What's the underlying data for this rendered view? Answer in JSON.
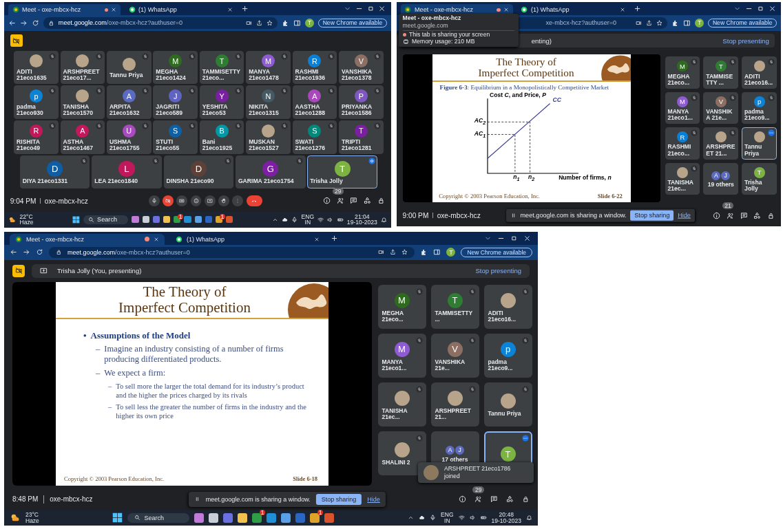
{
  "screens": [
    {
      "browser": {
        "tabs": [
          {
            "kind": "meet",
            "title": "Meet - oxe-mbcx-hcz",
            "selected": true,
            "recording": true
          },
          {
            "kind": "whatsapp",
            "title": "(1) WhatsApp",
            "selected": false,
            "recording": false
          }
        ],
        "url": {
          "host": "meet.google.com",
          "path": "/oxe-mbcx-hcz?authuser=0"
        },
        "profile": "T",
        "update": "New Chrome available"
      },
      "camera_off": true,
      "tile_rows": [
        [
          {
            "name": "ADITI 21eco1635",
            "kind": "photo",
            "muted": true,
            "selected": false
          },
          {
            "name": "ARSHPREET 21eco17...",
            "kind": "photo",
            "muted": true,
            "selected": false
          },
          {
            "name": "Tannu Priya",
            "kind": "photo",
            "muted": true,
            "selected": false
          },
          {
            "name": "MEGHA 21eco1424",
            "kind": "letter",
            "letter": "M",
            "color": "#2e6b1f",
            "muted": true,
            "selected": false
          },
          {
            "name": "TAMMISETTY 21eco...",
            "kind": "letter",
            "letter": "T",
            "color": "#2e7d32",
            "muted": true,
            "selected": false
          },
          {
            "name": "MANYA 21eco1478",
            "kind": "letter",
            "letter": "M",
            "color": "#8e5bd0",
            "muted": true,
            "selected": false
          },
          {
            "name": "RASHMI 21eco1936",
            "kind": "letter",
            "letter": "R",
            "color": "#0b7fd4",
            "muted": true,
            "selected": false
          },
          {
            "name": "VANSHIKA 21eco1378",
            "kind": "letter",
            "letter": "V",
            "color": "#8d6e63",
            "muted": true,
            "selected": false
          }
        ],
        [
          {
            "name": "padma 21eco930",
            "kind": "letter",
            "letter": "p",
            "color": "#0b84d8",
            "muted": true,
            "selected": false
          },
          {
            "name": "TANISHA 21eco1570",
            "kind": "photo",
            "muted": true,
            "selected": false
          },
          {
            "name": "ARPITA 21eco1632",
            "kind": "letter",
            "letter": "A",
            "color": "#5c6bc0",
            "muted": true,
            "selected": false
          },
          {
            "name": "JAGRITI 21eco589",
            "kind": "letter",
            "letter": "J",
            "color": "#5f63c4",
            "muted": true,
            "selected": false
          },
          {
            "name": "YESHITA 21eco53",
            "kind": "letter",
            "letter": "Y",
            "color": "#7b1fa2",
            "muted": true,
            "selected": false
          },
          {
            "name": "NIKITA 21eco1315",
            "kind": "letter",
            "letter": "N",
            "color": "#455a64",
            "muted": true,
            "selected": false
          },
          {
            "name": "AASTHA 21eco1288",
            "kind": "letter",
            "letter": "A",
            "color": "#ab47bc",
            "muted": true,
            "selected": false
          },
          {
            "name": "PRIYANKA 21eco1586",
            "kind": "letter",
            "letter": "P",
            "color": "#7e57c2",
            "muted": true,
            "selected": false
          }
        ],
        [
          {
            "name": "RISHITA 21eco49",
            "kind": "letter",
            "letter": "R",
            "color": "#c2185b",
            "muted": true,
            "selected": false
          },
          {
            "name": "ASTHA 21eco1467",
            "kind": "letter",
            "letter": "A",
            "color": "#c4185c",
            "muted": true,
            "selected": false
          },
          {
            "name": "USHMA 21eco1755",
            "kind": "letter",
            "letter": "U",
            "color": "#a94bc0",
            "muted": true,
            "selected": false
          },
          {
            "name": "STUTI 21eco55",
            "kind": "letter",
            "letter": "S",
            "color": "#0d5fa6",
            "muted": true,
            "selected": false
          },
          {
            "name": "Bani 21eco1925",
            "kind": "letter",
            "letter": "B",
            "color": "#0097a7",
            "muted": true,
            "selected": false
          },
          {
            "name": "MUSKAN 21eco1527",
            "kind": "photo",
            "muted": true,
            "selected": false
          },
          {
            "name": "SWATI 21eco1276",
            "kind": "letter",
            "letter": "S",
            "color": "#00897b",
            "muted": true,
            "selected": false
          },
          {
            "name": "TRIPTI 21eco1281",
            "kind": "letter",
            "letter": "T",
            "color": "#7a1fa0",
            "muted": true,
            "selected": false
          }
        ],
        [
          {
            "name": "DIYA 21eco1331",
            "kind": "letter",
            "letter": "D",
            "color": "#0e5ea5",
            "muted": true,
            "selected": false
          },
          {
            "name": "LEA 21eco1840",
            "kind": "letter",
            "letter": "L",
            "color": "#c0185a",
            "muted": true,
            "selected": false
          },
          {
            "name": "DINSHA 21eco90",
            "kind": "letter",
            "letter": "D",
            "color": "#5d4037",
            "muted": true,
            "selected": false
          },
          {
            "name": "GARIMA 21eco1754",
            "kind": "letter",
            "letter": "G",
            "color": "#7c1fa3",
            "muted": true,
            "selected": false
          },
          {
            "name": "Trisha Jolly",
            "kind": "letter",
            "letter": "T",
            "color": "#7cb342",
            "muted": false,
            "speaking": true,
            "selected": true
          }
        ]
      ],
      "meeting": {
        "time": "9:04 PM",
        "code": "oxe-mbcx-hcz",
        "participants": "29"
      },
      "taskbar": {
        "temperature": "22°C",
        "weather": "Haze",
        "search": "Search",
        "badges": [
          "1",
          "1"
        ],
        "language": "ENG",
        "region": "IN",
        "time": "21:04",
        "date": "19-10-2023"
      }
    },
    {
      "browser": {
        "tabs": [
          {
            "kind": "meet",
            "title": "Meet - oxe-mbcx-hcz",
            "selected": true,
            "recording": true
          },
          {
            "kind": "whatsapp",
            "title": "(1) WhatsApp",
            "selected": false,
            "recording": false
          }
        ],
        "url": {
          "path": "xe-mbcx-hcz?authuser=0"
        },
        "profile": "T",
        "update": "New Chrome available"
      },
      "tooltip": {
        "title": "Meet - oxe-mbcx-hcz",
        "site": "meet.google.com",
        "sharing": "This tab is sharing your screen",
        "memory": "Memory usage: 210 MB"
      },
      "presenting": {
        "text": "enting)",
        "stop": "Stop presenting"
      },
      "slide": {
        "title": [
          "The Theory of",
          "Imperfect Competition"
        ],
        "caption": "**Figure 6-3**: Equilibrium in a Monopolistically Competitive Market",
        "figure": {
          "y_label": "Cost *C*, and Price, *P*",
          "curve": "CC",
          "y_marks": [
            "AC$_{2}$",
            "AC$_{1}$"
          ],
          "x_marks": [
            "n$_{1}$",
            "n$_{2}$"
          ],
          "x_label": "Number of firms, *n*"
        },
        "copyright": "Copyright © 2003 Pearson Education, Inc.",
        "number": "Slide 6-22"
      },
      "tile_rows": [
        [
          {
            "name": "MEGHA 21eco...",
            "kind": "letter",
            "letter": "M",
            "color": "#2e6b1f",
            "muted": true,
            "selected": false
          },
          {
            "name": "TAMMISETTY ...",
            "kind": "letter",
            "letter": "T",
            "color": "#2e7d32",
            "muted": true,
            "selected": false
          },
          {
            "name": "ADITI 21eco16...",
            "kind": "photo",
            "muted": true,
            "selected": false
          }
        ],
        [
          {
            "name": "MANYA 21eco1...",
            "kind": "letter",
            "letter": "M",
            "color": "#8e5bd0",
            "muted": true,
            "selected": false
          },
          {
            "name": "VANSHIKA 21e...",
            "kind": "letter",
            "letter": "V",
            "color": "#8d6e63",
            "muted": true,
            "selected": false
          },
          {
            "name": "padma 21eco9...",
            "kind": "letter",
            "letter": "p",
            "color": "#0b84d8",
            "muted": true,
            "selected": false
          }
        ],
        [
          {
            "name": "RASHMI 21eco...",
            "kind": "letter",
            "letter": "R",
            "color": "#0b7fd4",
            "muted": true,
            "selected": false
          },
          {
            "name": "ARSHPREET 21...",
            "kind": "photo",
            "muted": true,
            "selected": false
          },
          {
            "name": "Tannu Priya",
            "kind": "photo",
            "muted": false,
            "menu": true,
            "selected": true
          }
        ],
        [
          {
            "name": "TANISHA 21ec...",
            "kind": "photo",
            "muted": true,
            "selected": false
          },
          {
            "name": "19 others",
            "kind": "group",
            "letters": [
              "A",
              "J"
            ],
            "color": "#5c6bc0",
            "muted": false,
            "selected": false
          },
          {
            "name": "Trisha Jolly",
            "kind": "letter",
            "letter": "T",
            "color": "#7cb342",
            "muted": false,
            "selected": false
          }
        ]
      ],
      "meeting": {
        "time": "9:00 PM",
        "code": "oxe-mbcx-hcz",
        "participants": "21"
      },
      "share_notice": {
        "text": "meet.google.com is sharing a window.",
        "stop": "Stop sharing",
        "hide": "Hide"
      }
    },
    {
      "browser": {
        "tabs": [
          {
            "kind": "meet",
            "title": "Meet - oxe-mbcx-hcz",
            "selected": true,
            "recording": true
          },
          {
            "kind": "whatsapp",
            "title": "(1) WhatsApp",
            "selected": false,
            "recording": false
          }
        ],
        "url": {
          "host": "meet.google.com",
          "path": "/oxe-mbcx-hcz?authuser=0"
        },
        "profile": "T",
        "update": "New Chrome available"
      },
      "camera_off": true,
      "presenting": {
        "text": "Trisha Jolly (You, presenting)",
        "stop": "Stop presenting"
      },
      "slide": {
        "title": [
          "The Theory of",
          "Imperfect Competition"
        ],
        "bullets": [
          {
            "marker": "•",
            "text": "Assumptions of the Model",
            "children": [
              {
                "marker": "–",
                "text": "Imagine an industry consisting of a number of firms producing differentiated products."
              },
              {
                "marker": "–",
                "text": "We expect a firm:",
                "children": [
                  {
                    "marker": "–",
                    "text": "To sell more the larger the total demand for its industry’s product and the higher the prices charged by its rivals"
                  },
                  {
                    "marker": "–",
                    "text": "To sell less the greater the number of firms in the industry and the higher its own price"
                  }
                ]
              }
            ]
          }
        ],
        "copyright": "Copyright © 2003 Pearson Education, Inc.",
        "number": "Slide 6-18"
      },
      "tile_rows": [
        [
          {
            "name": "MEGHA 21eco...",
            "kind": "letter",
            "letter": "M",
            "color": "#2e6b1f",
            "muted": true,
            "selected": false
          },
          {
            "name": "TAMMISETTY ...",
            "kind": "letter",
            "letter": "T",
            "color": "#2e7d32",
            "muted": true,
            "selected": false
          },
          {
            "name": "ADITI 21eco16...",
            "kind": "photo",
            "muted": true,
            "selected": false
          }
        ],
        [
          {
            "name": "MANYA 21eco1...",
            "kind": "letter",
            "letter": "M",
            "color": "#8e5bd0",
            "muted": true,
            "selected": false
          },
          {
            "name": "VANSHIKA 21e...",
            "kind": "letter",
            "letter": "V",
            "color": "#8d6e63",
            "muted": true,
            "selected": false
          },
          {
            "name": "padma 21eco9...",
            "kind": "letter",
            "letter": "p",
            "color": "#0b84d8",
            "muted": true,
            "selected": false
          }
        ],
        [
          {
            "name": "TANISHA 21ec...",
            "kind": "photo",
            "muted": true,
            "selected": false
          },
          {
            "name": "ARSHPREET 21...",
            "kind": "photo",
            "muted": true,
            "selected": false
          },
          {
            "name": "Tannu Priya",
            "kind": "photo",
            "muted": true,
            "selected": false
          }
        ],
        [
          {
            "name": "SHALINI 2",
            "kind": "photo",
            "muted": true,
            "selected": false
          },
          {
            "name": "17 others",
            "kind": "group",
            "letters": [
              "A",
              "J"
            ],
            "color": "#5c6bc0",
            "muted": false,
            "selected": false
          },
          {
            "kind": "letter",
            "letter": "T",
            "color": "#7cb342",
            "muted": false,
            "menu": true,
            "selected": true
          }
        ]
      ],
      "toast": {
        "name": "ARSHPREET 21eco1786",
        "text": "joined"
      },
      "meeting": {
        "time": "8:48 PM",
        "code": "oxe-mbcx-hcz",
        "participants": "29"
      },
      "share_notice": {
        "text": "meet.google.com is sharing a window.",
        "stop": "Stop sharing",
        "hide": "Hide"
      },
      "taskbar": {
        "temperature": "23°C",
        "weather": "Haze",
        "search": "Search",
        "badges": [
          "1",
          "1"
        ],
        "language": "ENG",
        "region": "IN",
        "time": "20:48",
        "date": "19-10-2023"
      }
    }
  ]
}
